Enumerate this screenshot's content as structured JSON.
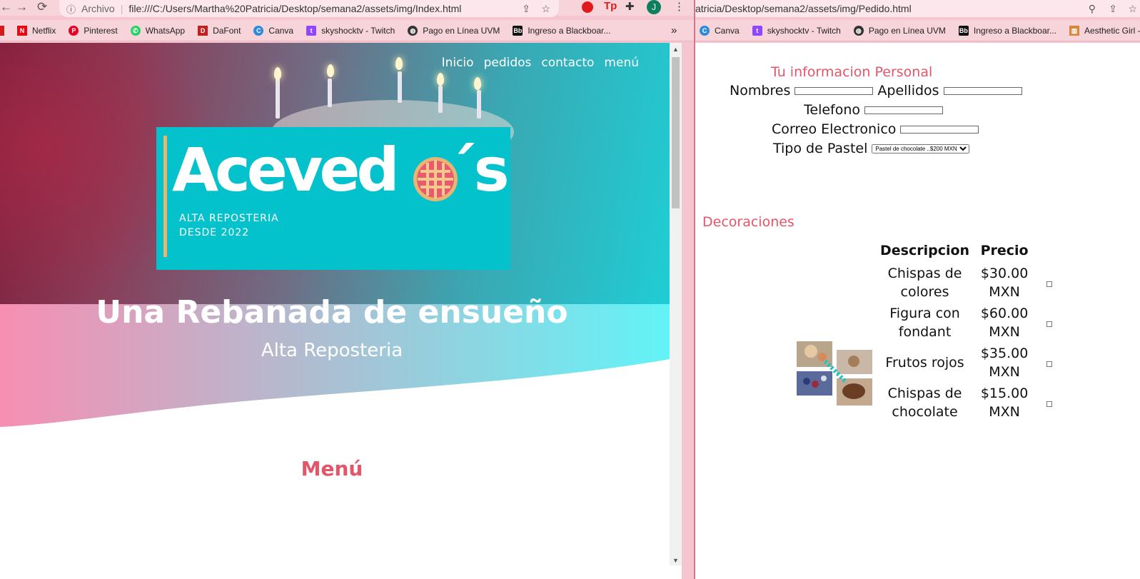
{
  "left_window": {
    "url_prefix": "Archivo",
    "url": "file:///C:/Users/Martha%20Patricia/Desktop/semana2/assets/img/Index.html",
    "bookmarks": [
      "Netflix",
      "Pinterest",
      "WhatsApp",
      "DaFont",
      "Canva",
      "skyshocktv - Twitch",
      "Pago en Línea UVM",
      "Ingreso a Blackboar..."
    ],
    "bookmarks_more": "»",
    "profile_initial": "J",
    "nav": [
      "Inicio",
      "pedidos",
      "contacto",
      "menú"
    ],
    "logo": {
      "word_left": "Aceved",
      "word_right": "´s",
      "tagline1": "ALTA REPOSTERIA",
      "tagline2": "DESDE 2022"
    },
    "hero_title": "Una Rebanada de ensueño",
    "hero_subtitle": "Alta Reposteria",
    "section_title": "Menú"
  },
  "right_window": {
    "url": "atricia/Desktop/semana2/assets/img/Pedido.html",
    "bookmarks": [
      "Canva",
      "skyshocktv - Twitch",
      "Pago en Línea UVM",
      "Ingreso a Blackboar...",
      "Aesthetic Girl - "
    ],
    "form_title": "Tu informacion Personal",
    "labels": {
      "nombres": "Nombres",
      "apellidos": "Apellidos",
      "telefono": "Telefono",
      "correo": "Correo Electronico",
      "tipo": "Tipo de Pastel"
    },
    "tipo_selected": "Pastel de chocolate ..$200 MXN",
    "decor_title": "Decoraciones",
    "table_headers": [
      "Descripcion",
      "Precio"
    ],
    "items": [
      {
        "desc": "Chispas de colores",
        "price": "$30.00 MXN"
      },
      {
        "desc": "Figura con fondant",
        "price": "$60.00 MXN"
      },
      {
        "desc": "Frutos rojos",
        "price": "$35.00 MXN"
      },
      {
        "desc": "Chispas de chocolate",
        "price": "$15.00 MXN"
      }
    ]
  },
  "colors": {
    "accent_pink": "#e3566a",
    "teal": "#03c2cc",
    "chrome": "#f7d3da"
  }
}
